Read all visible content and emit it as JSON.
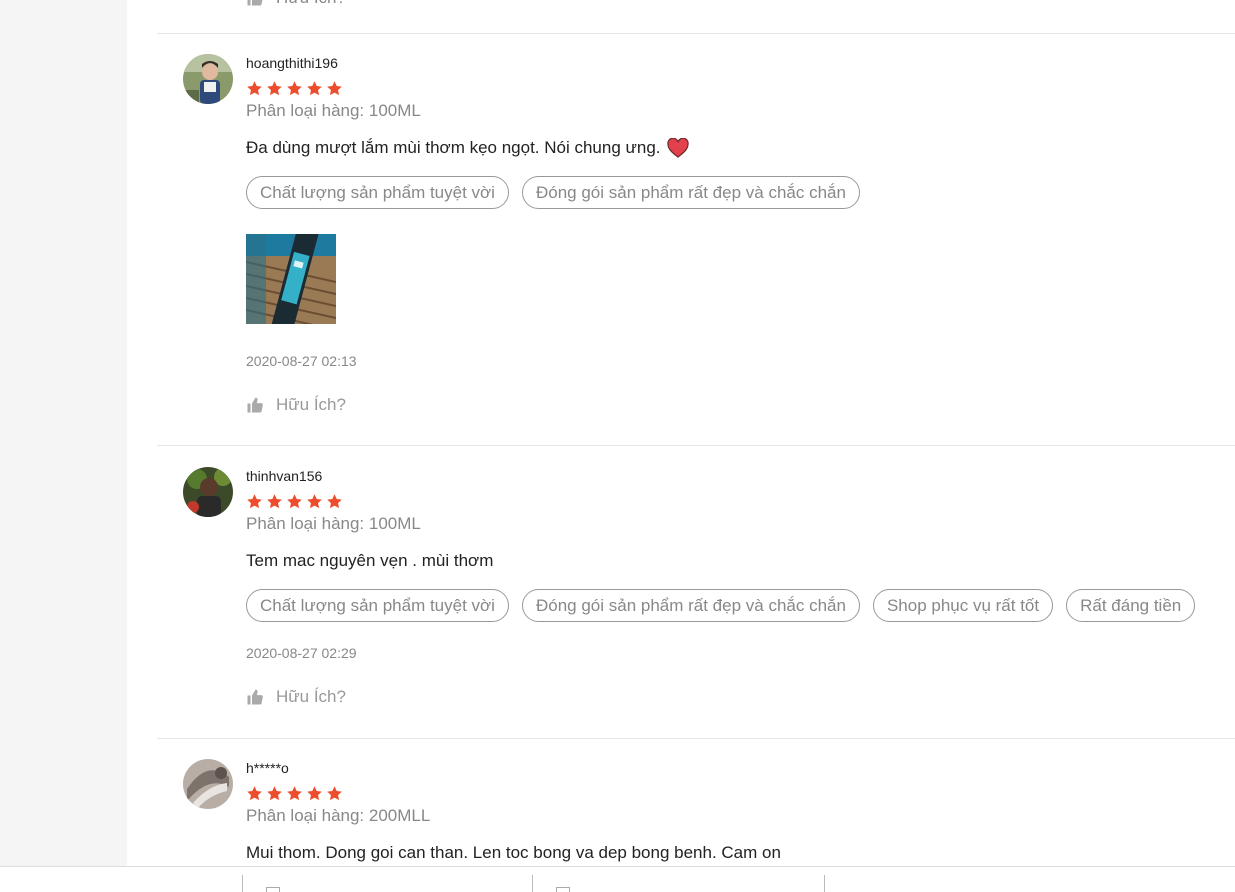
{
  "helpful_label": "Hữu Ích?",
  "reviews": [
    {
      "username": "hoangthithi196",
      "rating": 5,
      "variant": "Phân loại hàng: 100ML",
      "comment": "Đa dùng mượt lắm mùi thơm kẹo ngọt. Nói chung ưng.",
      "emoji": "heart-icon",
      "tags": [
        "Chất lượng sản phẩm tuyệt vời",
        "Đóng gói sản phẩm rất đẹp và chắc chắn"
      ],
      "time": "2020-08-27 02:13"
    },
    {
      "username": "thinhvan156",
      "rating": 5,
      "variant": "Phân loại hàng: 100ML",
      "comment": "Tem mac nguyên vẹn .  mùi thơm",
      "tags": [
        "Chất lượng sản phẩm tuyệt vời",
        "Đóng gói sản phẩm rất đẹp và chắc chắn",
        "Shop phục vụ rất tốt",
        "Rất đáng tiền"
      ],
      "time": "2020-08-27 02:29"
    },
    {
      "username": "h*****o",
      "rating": 5,
      "variant": "Phân loại hàng: 200MLL",
      "comment": "Mui thom. Dong goi can than. Len toc bong va dep bong benh. Cam on"
    }
  ],
  "colors": {
    "star": "#ee4d2d",
    "tag_border": "#999999",
    "muted_text": "#888888"
  }
}
